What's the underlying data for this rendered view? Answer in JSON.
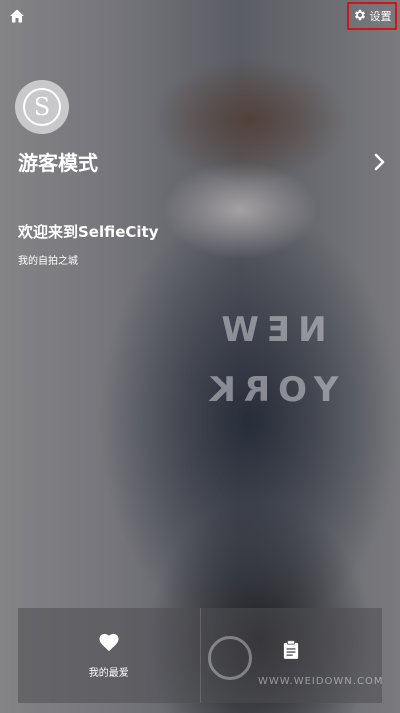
{
  "header": {
    "home_icon": "home-icon",
    "settings": {
      "icon": "gear-icon",
      "label": "设置",
      "highlight_color": "#d0141a"
    }
  },
  "profile": {
    "avatar_letter": "S",
    "guest_mode_label": "游客模式",
    "chevron_icon": "chevron-right-icon"
  },
  "welcome": {
    "title": "欢迎来到SelfieCity",
    "subtitle": "我的自拍之城"
  },
  "background_photo": {
    "jacket_text": "NEW YORK"
  },
  "bottom_nav": {
    "items": [
      {
        "icon": "heart-icon",
        "label": "我的最爱"
      },
      {
        "icon": "clipboard-icon",
        "label": ""
      }
    ]
  },
  "watermark": {
    "text": "WWW.WEIDOWN.COM"
  }
}
